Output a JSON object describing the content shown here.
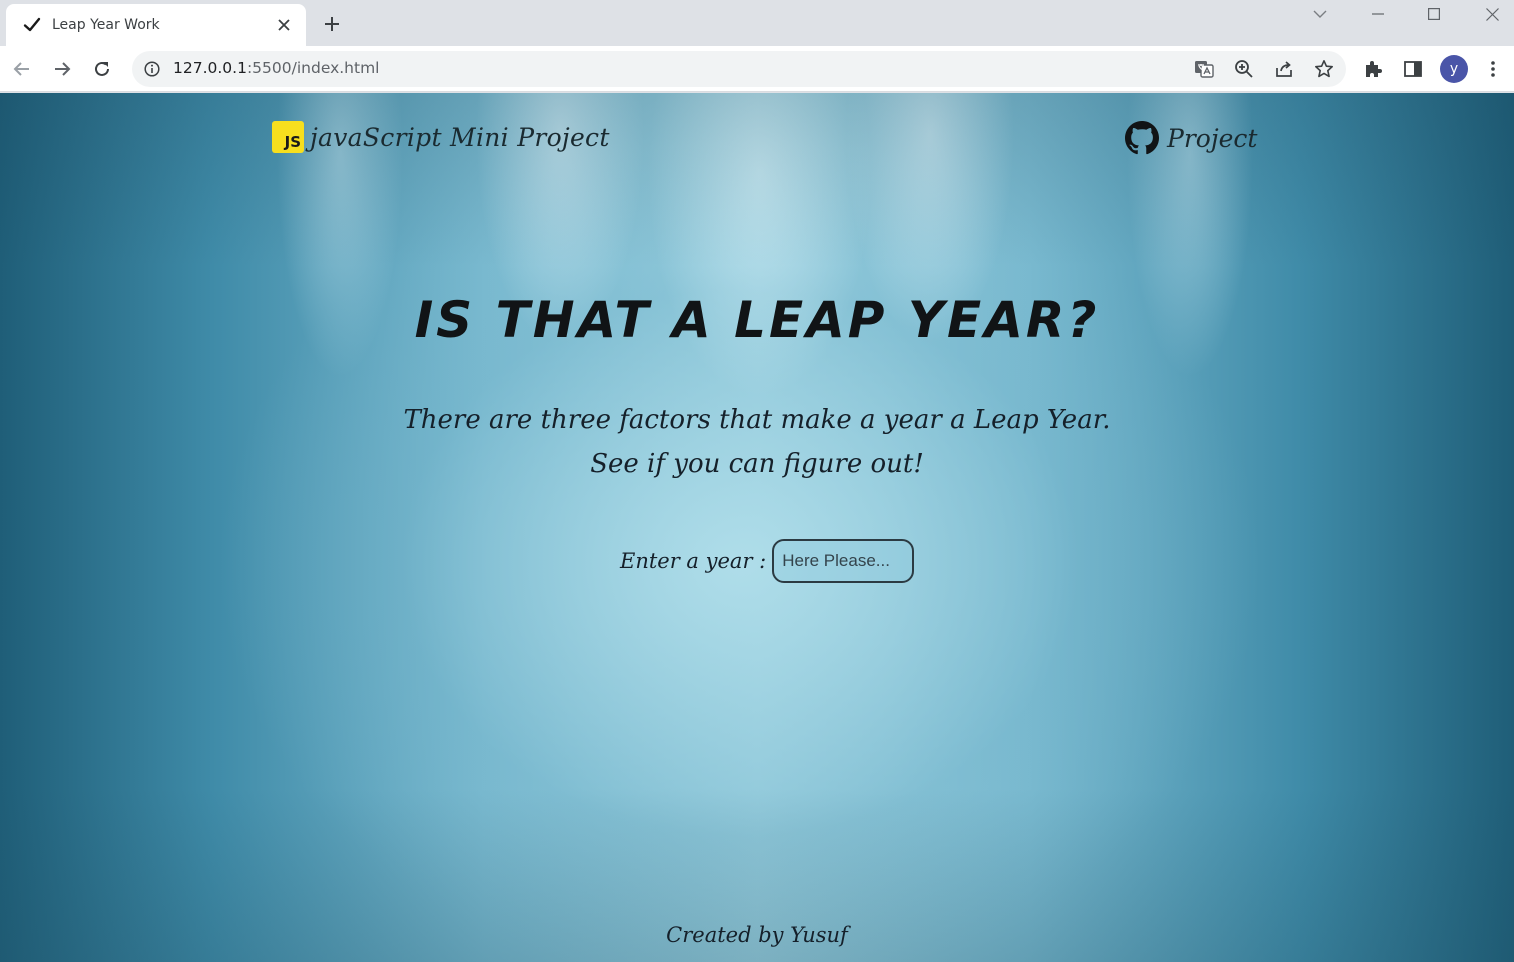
{
  "browser": {
    "tab_title": "Leap Year Work",
    "url_host": "127.0.0.1",
    "url_rest": ":5500/index.html",
    "profile_initial": "y"
  },
  "page": {
    "brand_badge": "JS",
    "brand_text": "javaScript Mini Project",
    "repo_link_text": "Project",
    "headline": "IS THAT A LEAP YEAR?",
    "subtitle_line1": "There are three factors that make a year a Leap Year.",
    "subtitle_line2": "See if you can figure out!",
    "year_label": "Enter a year :",
    "year_placeholder": "Here Please...",
    "year_value": "",
    "footer": "Created by Yusuf"
  },
  "colors": {
    "js_badge": "#f7df1e",
    "avatar": "#4a55a8",
    "background_center": "#9ed2e1",
    "background_edge": "#1f5e78"
  }
}
